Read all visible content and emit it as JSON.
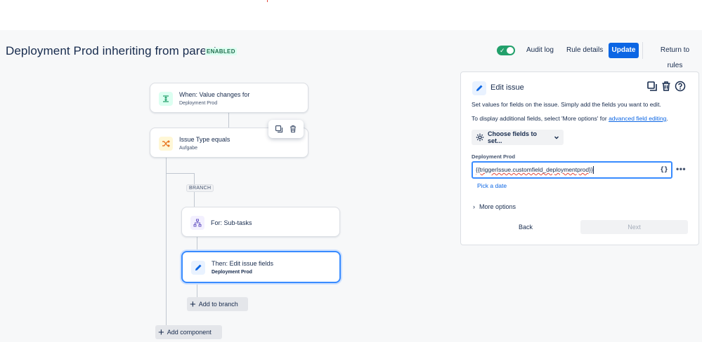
{
  "header": {
    "title": "Deployment Prod inheriting from parent",
    "status_badge": "ENABLED",
    "toggle_on": true,
    "audit_log": "Audit log",
    "rule_details": "Rule details",
    "update": "Update",
    "return_to_rules": "Return to rules"
  },
  "canvas": {
    "trigger": {
      "title": "When: Value changes for",
      "subtitle": "Deployment Prod",
      "icon": "value-change-icon"
    },
    "condition": {
      "title": "Issue Type equals",
      "subtitle": "Aufgabe",
      "icon": "shuffle-icon"
    },
    "branch_label": "BRANCH",
    "branch_card": {
      "title": "For: Sub-tasks",
      "icon": "hierarchy-icon"
    },
    "action_card": {
      "title": "Then: Edit issue fields",
      "subtitle": "Deployment Prod",
      "icon": "pencil-icon"
    },
    "add_to_branch": "Add to branch",
    "add_component": "Add component"
  },
  "panel": {
    "title": "Edit issue",
    "description1": "Set values for fields on the issue. Simply add the fields you want to edit.",
    "description2_prefix": "To display additional fields, select 'More options' for ",
    "description2_link": "advanced field editing",
    "description2_suffix": ".",
    "choose_fields": "Choose fields to set...",
    "field_label": "Deployment Prod",
    "field_value": "{{triggerIssue.customfield_deploymentprod}}",
    "smart_value_button": "{}",
    "pick_date": "Pick a date",
    "more_options": "More options",
    "back": "Back",
    "next": "Next"
  },
  "colors": {
    "primary": "#0c66e4",
    "enabled_green": "#22a06b",
    "selected_border": "#388bff"
  }
}
